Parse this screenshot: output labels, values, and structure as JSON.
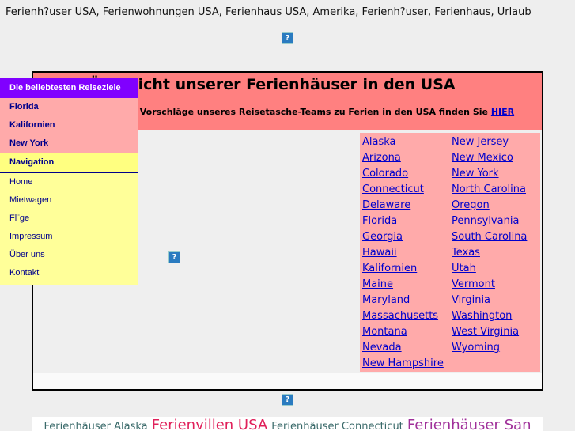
{
  "page_title_line": "Ferienh?user USA, Ferienwohnungen USA, Ferienhaus USA, Amerika, Ferienh?user, Ferienhaus, Urlaub",
  "broken_image_icon": "?",
  "main": {
    "title": "Übersicht unserer Ferienhäuser in den USA",
    "subtitle": "Tipps und Vorschläge unseres Reisetasche-Teams zu Ferien in den USA finden Sie",
    "subtitle_link": "HIER",
    "states_left": [
      "Alaska",
      "Arizona",
      "Colorado",
      "Connecticut",
      "Delaware",
      "Florida",
      "Georgia",
      "Hawaii",
      "Kalifornien",
      "Maine",
      "Maryland",
      "Massachusetts",
      "Montana",
      "Nevada",
      "New Hampshire"
    ],
    "states_right": [
      "New Jersey",
      "New Mexico",
      "New York",
      "North Carolina",
      "Oregon",
      "Pennsylvania",
      "South Carolina",
      "Texas",
      "Utah",
      "Vermont",
      "Virginia",
      "Washington",
      "West Virginia",
      "Wyoming"
    ]
  },
  "sidebar": {
    "popular_header": "Die beliebtesten Reiseziele",
    "popular": [
      "Florida",
      "Kalifornien",
      "New York"
    ],
    "nav_header": "Navigation",
    "nav": [
      "Home",
      "Mietwagen",
      "Fl¨ge",
      "Impressum",
      "Über uns",
      "Kontakt"
    ]
  },
  "tags": [
    {
      "text": "Ferienhäuser Alaska",
      "color": "#3a6a6a",
      "size": 13
    },
    {
      "text": "Ferienvillen USA",
      "color": "#e0205a",
      "size": 18
    },
    {
      "text": "Ferienhäuser Connecticut",
      "color": "#3a6a6a",
      "size": 13
    },
    {
      "text": "Ferienhäuser San",
      "color": "#a0309a",
      "size": 18
    }
  ]
}
